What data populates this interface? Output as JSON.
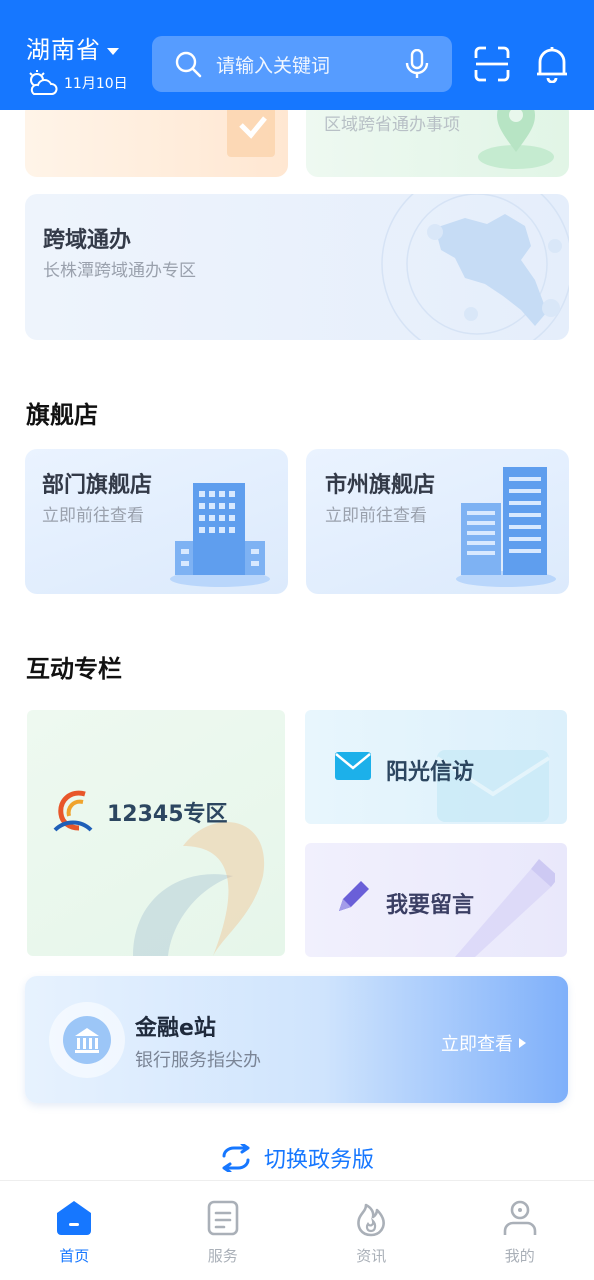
{
  "header": {
    "province": "湖南省",
    "date": "11月10日",
    "search_placeholder": "请输入关键词"
  },
  "top_cards": {
    "right_sub": "区域跨省通办事项"
  },
  "cross_region": {
    "title": "跨域通办",
    "subtitle": "长株潭跨域通办专区"
  },
  "flagship": {
    "heading": "旗舰店",
    "items": [
      {
        "title": "部门旗舰店",
        "subtitle": "立即前往查看"
      },
      {
        "title": "市州旗舰店",
        "subtitle": "立即前往查看"
      }
    ]
  },
  "interactive": {
    "heading": "互动专栏",
    "hotline": "12345专区",
    "petition": "阳光信访",
    "message": "我要留言"
  },
  "finance": {
    "title": "金融e站",
    "subtitle": "银行服务指尖办",
    "action": "立即查看"
  },
  "switch_label": "切换政务版",
  "tabs": [
    {
      "label": "首页",
      "icon": "home-icon"
    },
    {
      "label": "服务",
      "icon": "service-icon"
    },
    {
      "label": "资讯",
      "icon": "flame-icon"
    },
    {
      "label": "我的",
      "icon": "person-icon"
    }
  ],
  "colors": {
    "accent": "#1677ff",
    "tab_inactive": "#aab0b8"
  }
}
